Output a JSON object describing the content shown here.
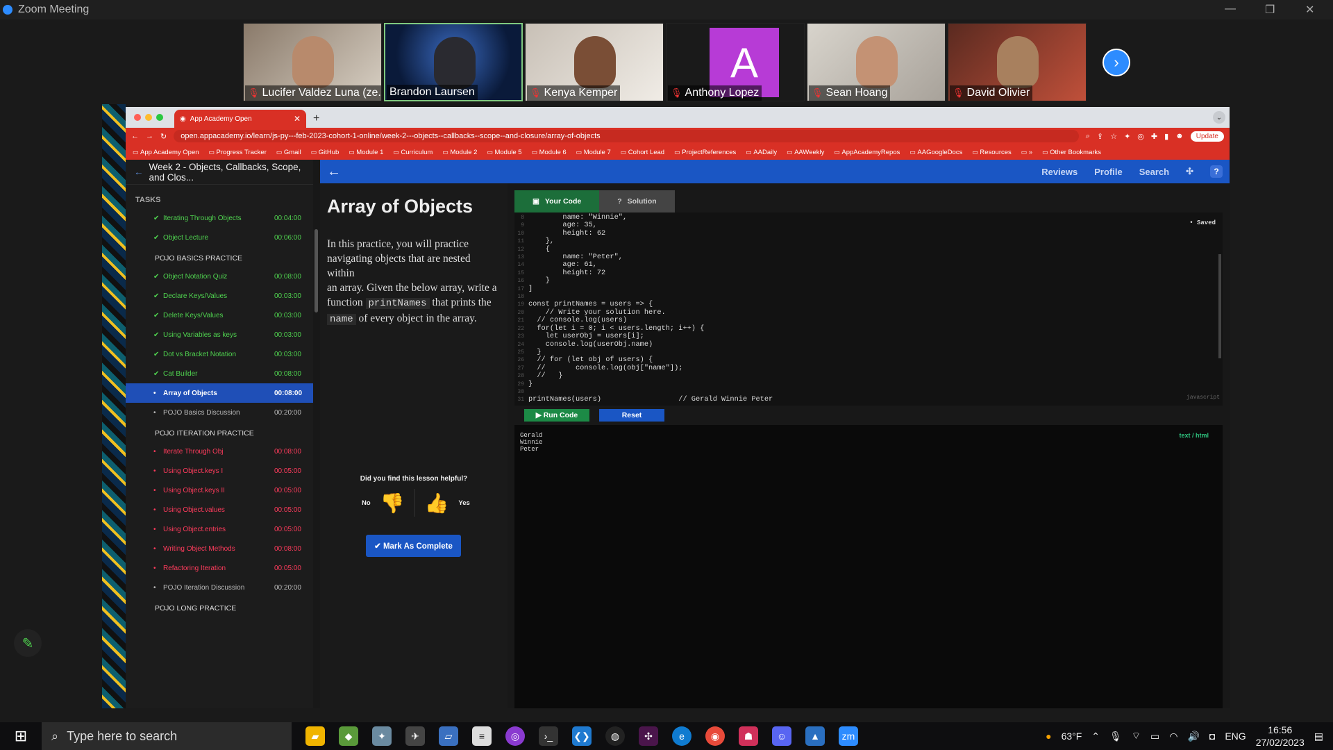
{
  "zoom": {
    "title": "Zoom Meeting"
  },
  "participants": [
    {
      "name": "Lucifer Valdez Luna (ze...",
      "muted": true
    },
    {
      "name": "Brandon Laursen",
      "muted": false
    },
    {
      "name": "Kenya Kemper",
      "muted": true
    },
    {
      "name": "Anthony Lopez",
      "muted": true,
      "initial": "A"
    },
    {
      "name": "Sean Hoang",
      "muted": true
    },
    {
      "name": "David Olivier",
      "muted": true
    }
  ],
  "browser": {
    "tab_title": "App Academy Open",
    "url": "open.appacademy.io/learn/js-py---feb-2023-cohort-1-online/week-2---objects--callbacks--scope--and-closure/array-of-objects",
    "update_label": "Update",
    "bookmarks": [
      "App Academy Open",
      "Progress Tracker",
      "Gmail",
      "GitHub",
      "Module 1",
      "Curriculum",
      "Module 2",
      "Module 5",
      "Module 6",
      "Module 7",
      "Cohort Lead",
      "ProjectReferences",
      "AADaily",
      "AAWeekly",
      "AppAcademyRepos",
      "AAGoogleDocs",
      "Resources",
      "»",
      "Other Bookmarks"
    ]
  },
  "sidebar": {
    "title": "Week 2 - Objects, Callbacks, Scope, and Clos...",
    "tasks_heading": "TASKS",
    "items": [
      {
        "kind": "task",
        "status": "done",
        "name": "Iterating Through Objects",
        "time": "00:04:00"
      },
      {
        "kind": "task",
        "status": "done",
        "name": "Object Lecture",
        "time": "00:06:00"
      },
      {
        "kind": "section",
        "name": "POJO BASICS PRACTICE"
      },
      {
        "kind": "task",
        "status": "done",
        "name": "Object Notation Quiz",
        "time": "00:08:00"
      },
      {
        "kind": "task",
        "status": "done",
        "name": "Declare Keys/Values",
        "time": "00:03:00"
      },
      {
        "kind": "task",
        "status": "done",
        "name": "Delete Keys/Values",
        "time": "00:03:00"
      },
      {
        "kind": "task",
        "status": "done",
        "name": "Using Variables as keys",
        "time": "00:03:00"
      },
      {
        "kind": "task",
        "status": "done",
        "name": "Dot vs Bracket Notation",
        "time": "00:03:00"
      },
      {
        "kind": "task",
        "status": "done",
        "name": "Cat Builder",
        "time": "00:08:00"
      },
      {
        "kind": "task",
        "status": "active",
        "name": "Array of Objects",
        "time": "00:08:00"
      },
      {
        "kind": "task",
        "status": "plain",
        "name": "POJO Basics Discussion",
        "time": "00:20:00"
      },
      {
        "kind": "section",
        "name": "POJO ITERATION PRACTICE"
      },
      {
        "kind": "task",
        "status": "todo",
        "name": "Iterate Through Obj",
        "time": "00:08:00"
      },
      {
        "kind": "task",
        "status": "todo",
        "name": "Using Object.keys I",
        "time": "00:05:00"
      },
      {
        "kind": "task",
        "status": "todo",
        "name": "Using Object.keys II",
        "time": "00:05:00"
      },
      {
        "kind": "task",
        "status": "todo",
        "name": "Using Object.values",
        "time": "00:05:00"
      },
      {
        "kind": "task",
        "status": "todo",
        "name": "Using Object.entries",
        "time": "00:05:00"
      },
      {
        "kind": "task",
        "status": "todo",
        "name": "Writing Object Methods",
        "time": "00:08:00"
      },
      {
        "kind": "task",
        "status": "todo",
        "name": "Refactoring Iteration",
        "time": "00:05:00"
      },
      {
        "kind": "task",
        "status": "plain",
        "name": "POJO Iteration Discussion",
        "time": "00:20:00"
      },
      {
        "kind": "section",
        "name": "POJO LONG PRACTICE"
      }
    ]
  },
  "header": {
    "reviews": "Reviews",
    "profile": "Profile",
    "search": "Search",
    "help": "?"
  },
  "lesson": {
    "title": "Array of Objects",
    "p1": "In this practice, you will practice navigating objects that are nested within",
    "p2a": "an array. Given the below array, write a function",
    "code1": "printNames",
    "p2b": "that prints the",
    "code2": "name",
    "p2c": "of every object in the array.",
    "helpful": "Did you find this lesson helpful?",
    "no": "No",
    "yes": "Yes",
    "complete": "✔ Mark As Complete"
  },
  "editor": {
    "tab_code": "Your Code",
    "tab_solution": "Solution",
    "saved": "• Saved",
    "language": "javascript",
    "run": "▶ Run Code",
    "reset": "Reset",
    "output_mode": "text / html",
    "output": [
      "Gerald",
      "Winnie",
      "Peter"
    ],
    "lines": [
      {
        "n": "8",
        "t": "        name: \"Winnie\","
      },
      {
        "n": "9",
        "t": "        age: 35,"
      },
      {
        "n": "10",
        "t": "        height: 62"
      },
      {
        "n": "11",
        "t": "    },"
      },
      {
        "n": "12",
        "t": "    {"
      },
      {
        "n": "13",
        "t": "        name: \"Peter\","
      },
      {
        "n": "14",
        "t": "        age: 61,"
      },
      {
        "n": "15",
        "t": "        height: 72"
      },
      {
        "n": "16",
        "t": "    }"
      },
      {
        "n": "17",
        "t": "]"
      },
      {
        "n": "18",
        "t": ""
      },
      {
        "n": "19",
        "t": "const printNames = users => {"
      },
      {
        "n": "20",
        "t": "    // Write your solution here."
      },
      {
        "n": "21",
        "t": "  // console.log(users)"
      },
      {
        "n": "22",
        "t": "  for(let i = 0; i < users.length; i++) {"
      },
      {
        "n": "23",
        "t": "    let userObj = users[i];"
      },
      {
        "n": "24",
        "t": "    console.log(userObj.name)"
      },
      {
        "n": "25",
        "t": "  }"
      },
      {
        "n": "26",
        "t": "  // for (let obj of users) {"
      },
      {
        "n": "27",
        "t": "  //       console.log(obj[\"name\"]);"
      },
      {
        "n": "28",
        "t": "  //   }"
      },
      {
        "n": "29",
        "t": "}"
      },
      {
        "n": "30",
        "t": ""
      },
      {
        "n": "31",
        "t": "printNames(users)                  // Gerald Winnie Peter"
      }
    ]
  },
  "taskbar": {
    "search_placeholder": "Type here to search",
    "weather": "63°F",
    "lang": "ENG",
    "time": "16:56",
    "date": "27/02/2023"
  }
}
